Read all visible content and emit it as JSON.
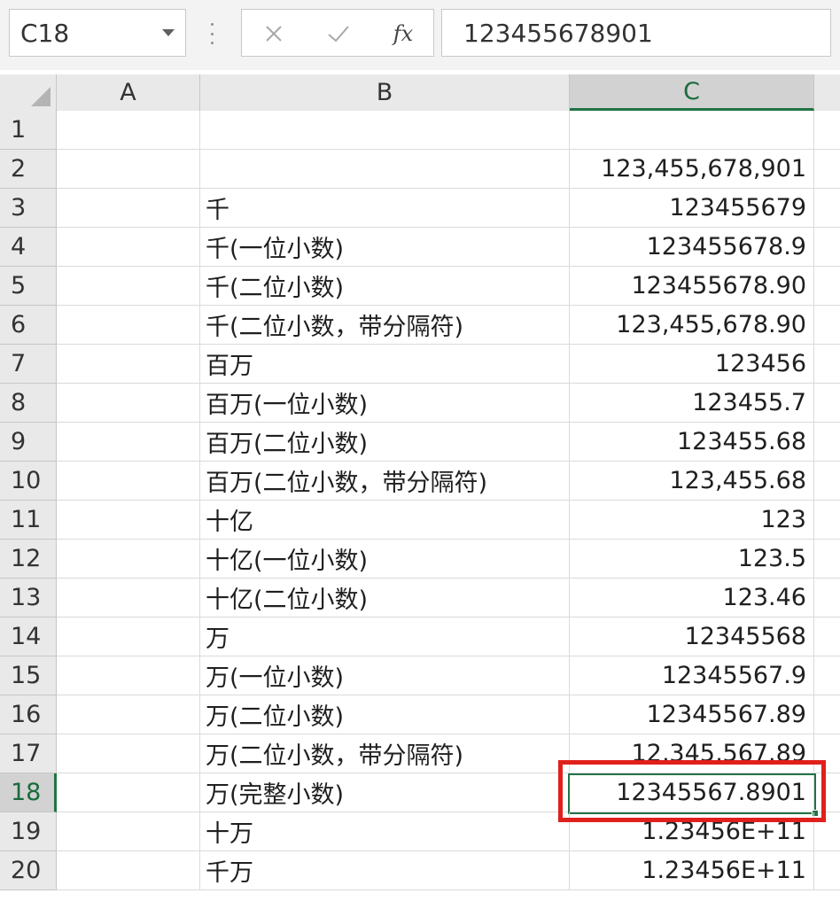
{
  "formula_bar": {
    "name_box": "C18",
    "cancel_icon": "close-icon",
    "enter_icon": "check-icon",
    "fx_label": "fx",
    "formula": "123455678901"
  },
  "columns": [
    "A",
    "B",
    "C"
  ],
  "active_column": "C",
  "active_row": "18",
  "rows": [
    {
      "num": "1",
      "b": "",
      "c": ""
    },
    {
      "num": "2",
      "b": "",
      "c": "123,455,678,901"
    },
    {
      "num": "3",
      "b": "千",
      "c": "123455679"
    },
    {
      "num": "4",
      "b": "千(一位小数)",
      "c": "123455678.9"
    },
    {
      "num": "5",
      "b": "千(二位小数)",
      "c": "123455678.90"
    },
    {
      "num": "6",
      "b": "千(二位小数，带分隔符)",
      "c": "123,455,678.90"
    },
    {
      "num": "7",
      "b": "百万",
      "c": "123456"
    },
    {
      "num": "8",
      "b": "百万(一位小数)",
      "c": "123455.7"
    },
    {
      "num": "9",
      "b": "百万(二位小数)",
      "c": "123455.68"
    },
    {
      "num": "10",
      "b": "百万(二位小数，带分隔符)",
      "c": "123,455.68"
    },
    {
      "num": "11",
      "b": "十亿",
      "c": "123"
    },
    {
      "num": "12",
      "b": "十亿(一位小数)",
      "c": "123.5"
    },
    {
      "num": "13",
      "b": "十亿(二位小数)",
      "c": "123.46"
    },
    {
      "num": "14",
      "b": "万",
      "c": "12345568"
    },
    {
      "num": "15",
      "b": "万(一位小数)",
      "c": "12345567.9"
    },
    {
      "num": "16",
      "b": "万(二位小数)",
      "c": "12345567.89"
    },
    {
      "num": "17",
      "b": "万(二位小数，带分隔符)",
      "c": "12,345,567.89"
    },
    {
      "num": "18",
      "b": "万(完整小数)",
      "c": "12345567.8901"
    },
    {
      "num": "19",
      "b": "十万",
      "c": "1.23456E+11"
    },
    {
      "num": "20",
      "b": "千万",
      "c": "1.23456E+11"
    }
  ],
  "colors": {
    "selection": "#217346",
    "highlight": "#e0201b"
  }
}
